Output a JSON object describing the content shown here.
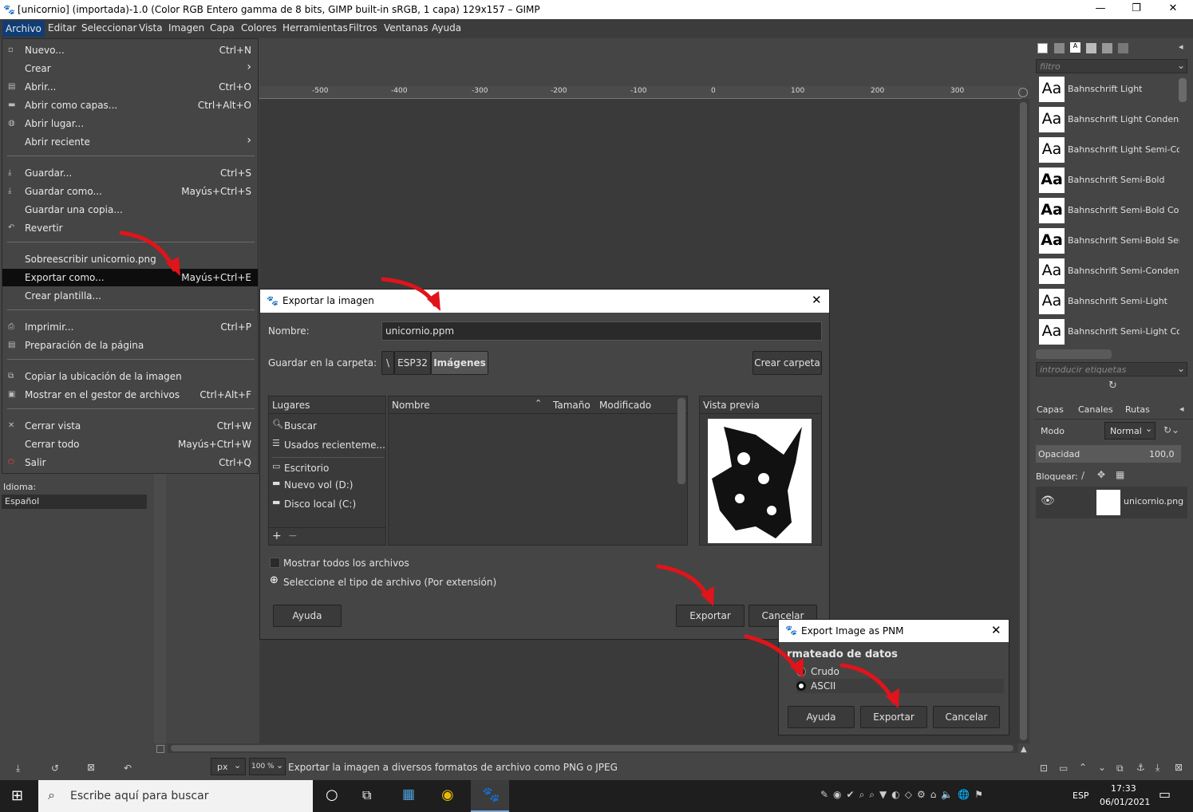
{
  "window": {
    "title": "[unicornio] (importada)-1.0 (Color RGB Entero gamma de 8 bits, GIMP built-in sRGB, 1 capa) 129x157 – GIMP",
    "minimize": "—",
    "maximize": "❐",
    "close": "✕"
  },
  "menubar": [
    "Archivo",
    "Editar",
    "Seleccionar",
    "Vista",
    "Imagen",
    "Capa",
    "Colores",
    "Herramientas",
    "Filtros",
    "Ventanas",
    "Ayuda"
  ],
  "file_menu": {
    "nuevo": {
      "label": "Nuevo...",
      "shortcut": "Ctrl+N"
    },
    "crear": {
      "label": "Crear",
      "shortcut": "›"
    },
    "abrir": {
      "label": "Abrir...",
      "shortcut": "Ctrl+O"
    },
    "abrir_capas": {
      "label": "Abrir como capas...",
      "shortcut": "Ctrl+Alt+O"
    },
    "abrir_lugar": {
      "label": "Abrir lugar..."
    },
    "abrir_reciente": {
      "label": "Abrir reciente",
      "shortcut": "›"
    },
    "guardar": {
      "label": "Guardar...",
      "shortcut": "Ctrl+S"
    },
    "guardar_como": {
      "label": "Guardar como...",
      "shortcut": "Mayús+Ctrl+S"
    },
    "guardar_copia": {
      "label": "Guardar una copia..."
    },
    "revertir": {
      "label": "Revertir"
    },
    "sobreescribir": {
      "label": "Sobreescribir unicornio.png"
    },
    "exportar_como": {
      "label": "Exportar como...",
      "shortcut": "Mayús+Ctrl+E"
    },
    "crear_plantilla": {
      "label": "Crear plantilla..."
    },
    "imprimir": {
      "label": "Imprimir...",
      "shortcut": "Ctrl+P"
    },
    "preparacion": {
      "label": "Preparación de la página"
    },
    "copiar_ubicacion": {
      "label": "Copiar la ubicación de la imagen"
    },
    "mostrar_gestor": {
      "label": "Mostrar en el gestor de archivos",
      "shortcut": "Ctrl+Alt+F"
    },
    "cerrar_vista": {
      "label": "Cerrar vista",
      "shortcut": "Ctrl+W"
    },
    "cerrar_todo": {
      "label": "Cerrar todo",
      "shortcut": "Mayús+Ctrl+W"
    },
    "salir": {
      "label": "Salir",
      "shortcut": "Ctrl+Q"
    }
  },
  "left_dock": {
    "idioma_label": "Idioma:",
    "idioma_value": "Español"
  },
  "ruler_ticks": [
    "-500",
    "-400",
    "-300",
    "-200",
    "-100",
    "0",
    "100",
    "200",
    "300"
  ],
  "export_dialog": {
    "title": "Exportar la imagen",
    "name_label": "Nombre:",
    "name_value": "unicornio.ppm",
    "folder_label": "Guardar en la carpeta:",
    "path": [
      "\\",
      "ESP32",
      "Imágenes"
    ],
    "create_folder": "Crear carpeta",
    "places_header": "Lugares",
    "places": [
      "Buscar",
      "Usados recienteme...",
      "Escritorio",
      "Nuevo vol (D:)",
      "Disco local (C:)"
    ],
    "columns": {
      "name": "Nombre",
      "size": "Tamaño",
      "modified": "Modificado"
    },
    "preview_header": "Vista previa",
    "show_all": "Mostrar todos los archivos",
    "file_type": "Seleccione el tipo de archivo (Por extensión)",
    "help": "Ayuda",
    "export": "Exportar",
    "cancel": "Cancelar"
  },
  "pnm_dialog": {
    "title": "Export Image as PNM",
    "section": "Formateado de datos",
    "section_visible": "rmateado de datos",
    "options": [
      "Crudo",
      "ASCII"
    ],
    "selected": "ASCII",
    "help": "Ayuda",
    "export": "Exportar",
    "cancel": "Cancelar"
  },
  "statusbar": {
    "unit": "px",
    "zoom": "100 %",
    "message": "Exportar la imagen a diversos formatos de archivo como PNG o JPEG"
  },
  "right_dock": {
    "filter_placeholder": "filtro",
    "fonts": [
      "Bahnschrift Light",
      "Bahnschrift Light Condensed",
      "Bahnschrift Light Semi-Conde",
      "Bahnschrift Semi-Bold",
      "Bahnschrift Semi-Bold Conde",
      "Bahnschrift Semi-Bold Semi-C",
      "Bahnschrift Semi-Condensed",
      "Bahnschrift Semi-Light",
      "Bahnschrift Semi-Light Conde"
    ],
    "tags_placeholder": "introducir etiquetas",
    "tabs": [
      "Capas",
      "Canales",
      "Rutas"
    ],
    "mode_label": "Modo",
    "mode_value": "Normal",
    "opacity_label": "Opacidad",
    "opacity_value": "100,0",
    "lock_label": "Bloquear:",
    "layer_name": "unicornio.png"
  },
  "taskbar": {
    "search_placeholder": "Escribe aquí para buscar",
    "lang": "ESP",
    "time": "17:33",
    "date": "06/01/2021"
  },
  "colors": {
    "accent": "#0f3d75",
    "arrow": "#e0141a"
  }
}
